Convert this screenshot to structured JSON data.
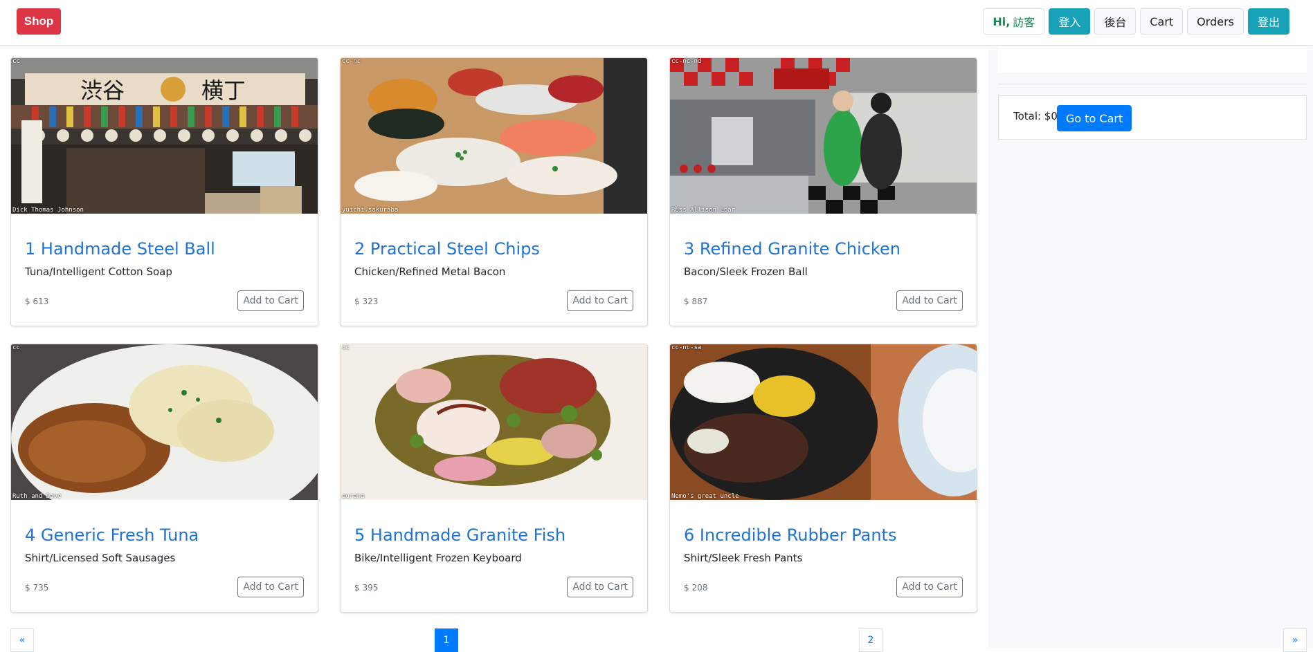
{
  "navbar": {
    "brand": "Shop",
    "greeting_hi": "Hi,",
    "greeting_name": "訪客",
    "login": "登入",
    "admin": "後台",
    "cart": "Cart",
    "orders": "Orders",
    "logout": "登出"
  },
  "products": [
    {
      "title": "1 Handmade Steel Ball",
      "subtitle": "Tuna/Intelligent Cotton Soap",
      "price": "$ 613",
      "button": "Add to Cart",
      "img_tag": "cc",
      "img_credit": "Dick Thomas Johnson"
    },
    {
      "title": "2 Practical Steel Chips",
      "subtitle": "Chicken/Refined Metal Bacon",
      "price": "$ 323",
      "button": "Add to Cart",
      "img_tag": "cc-nc",
      "img_credit": "yuichi.sakuraba"
    },
    {
      "title": "3 Refined Granite Chicken",
      "subtitle": "Bacon/Sleek Frozen Ball",
      "price": "$ 887",
      "button": "Add to Cart",
      "img_tag": "cc-nc-nd",
      "img_credit": "Russ Allison Loar"
    },
    {
      "title": "4 Generic Fresh Tuna",
      "subtitle": "Shirt/Licensed Soft Sausages",
      "price": "$ 735",
      "button": "Add to Cart",
      "img_tag": "cc",
      "img_credit": "Ruth and Dave"
    },
    {
      "title": "5 Handmade Granite Fish",
      "subtitle": "Bike/Intelligent Frozen Keyboard",
      "price": "$ 395",
      "button": "Add to Cart",
      "img_tag": "cc",
      "img_credit": "aurana"
    },
    {
      "title": "6 Incredible Rubber Pants",
      "subtitle": "Shirt/Sleek Fresh Pants",
      "price": "$ 208",
      "button": "Add to Cart",
      "img_tag": "cc-nc-sa",
      "img_credit": "Nemo's great uncle"
    }
  ],
  "sidebar": {
    "total": "Total: $0",
    "go_to_cart": "Go to Cart"
  },
  "pagination": {
    "prev": "«",
    "current": "1",
    "next_page": "2",
    "next": "»"
  },
  "colors": {
    "brand": "#dc3545",
    "info": "#17a2b8",
    "primary": "#007bff",
    "link": "#1f72d6"
  }
}
